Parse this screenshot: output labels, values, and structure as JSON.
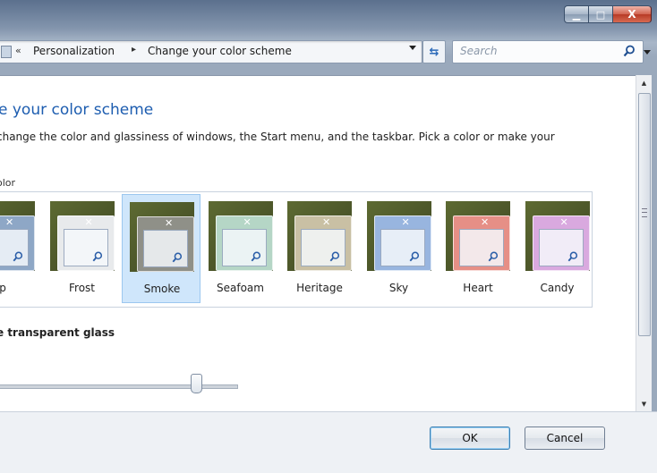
{
  "titlebar": {
    "close_glyph": "X"
  },
  "address": {
    "chevron": "«",
    "crumbs": [
      "Personalization",
      "Change your color scheme"
    ],
    "separator": "▸",
    "refresh_glyph": "⇆"
  },
  "search": {
    "placeholder": "Search"
  },
  "page": {
    "heading": "e your color scheme",
    "description": "change the color and glassiness of windows, the Start menu, and the taskbar. Pick a color or make your",
    "color_label": "olor",
    "transparency_label": "e transparent glass"
  },
  "swatches": [
    {
      "name": "p",
      "color": "#8ea7c6",
      "selected": false
    },
    {
      "name": "Frost",
      "color": "#e8eaec",
      "selected": false
    },
    {
      "name": "Smoke",
      "color": "#8f9088",
      "selected": true
    },
    {
      "name": "Seafoam",
      "color": "#b5d6c6",
      "selected": false
    },
    {
      "name": "Heritage",
      "color": "#c9c0a4",
      "selected": false
    },
    {
      "name": "Sky",
      "color": "#98b5df",
      "selected": false
    },
    {
      "name": "Heart",
      "color": "#e68f86",
      "selected": false
    },
    {
      "name": "Candy",
      "color": "#d9a9df",
      "selected": false
    }
  ],
  "buttons": {
    "ok": "OK",
    "cancel": "Cancel"
  },
  "colors": {
    "accent": "#1d5db0",
    "selection": "#cfe6fb"
  }
}
